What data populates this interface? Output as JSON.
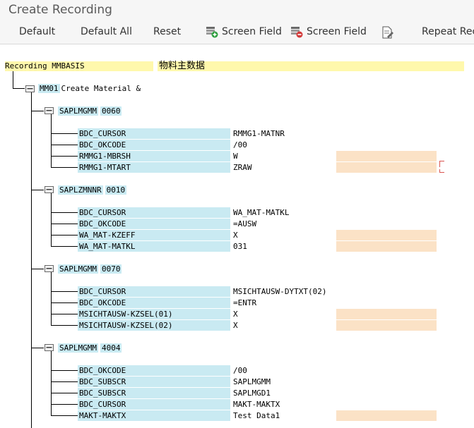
{
  "window": {
    "title": "Create Recording"
  },
  "toolbar": {
    "default": "Default",
    "default_all": "Default All",
    "reset": "Reset",
    "screen_field_add": "Screen Field",
    "screen_field_remove": "Screen Field",
    "repeat": "Repeat Reco"
  },
  "recording": {
    "name": "Recording MMBASIS",
    "description": "物料主数据",
    "transaction": {
      "code": "MM01",
      "text": "Create Material &"
    }
  },
  "screens": [
    {
      "program": "SAPLMGMM",
      "dynpro": "0060",
      "fields": [
        {
          "name": "BDC_CURSOR",
          "value": "RMMG1-MATNR"
        },
        {
          "name": "BDC_OKCODE",
          "value": "/00"
        },
        {
          "name": "RMMG1-MBRSH",
          "value": "W"
        },
        {
          "name": "RMMG1-MTART",
          "value": "ZRAW"
        }
      ]
    },
    {
      "program": "SAPLZMNNR",
      "dynpro": "0010",
      "fields": [
        {
          "name": "BDC_CURSOR",
          "value": "WA_MAT-MATKL"
        },
        {
          "name": "BDC_OKCODE",
          "value": "=AUSW"
        },
        {
          "name": "WA_MAT-KZEFF",
          "value": "X"
        },
        {
          "name": "WA_MAT-MATKL",
          "value": "031"
        }
      ]
    },
    {
      "program": "SAPLMGMM",
      "dynpro": "0070",
      "fields": [
        {
          "name": "BDC_CURSOR",
          "value": "MSICHTAUSW-DYTXT(02)"
        },
        {
          "name": "BDC_OKCODE",
          "value": "=ENTR"
        },
        {
          "name": "MSICHTAUSW-KZSEL(01)",
          "value": "X"
        },
        {
          "name": "MSICHTAUSW-KZSEL(02)",
          "value": "X"
        }
      ]
    },
    {
      "program": "SAPLMGMM",
      "dynpro": "4004",
      "fields": [
        {
          "name": "BDC_OKCODE",
          "value": "/00"
        },
        {
          "name": "BDC_SUBSCR",
          "value": "SAPLMGMM"
        },
        {
          "name": "BDC_SUBSCR",
          "value": "SAPLMGD1"
        },
        {
          "name": "BDC_CURSOR",
          "value": "MAKT-MAKTX"
        },
        {
          "name": "MAKT-MAKTX",
          "value": "Test Data1"
        }
      ]
    }
  ]
}
